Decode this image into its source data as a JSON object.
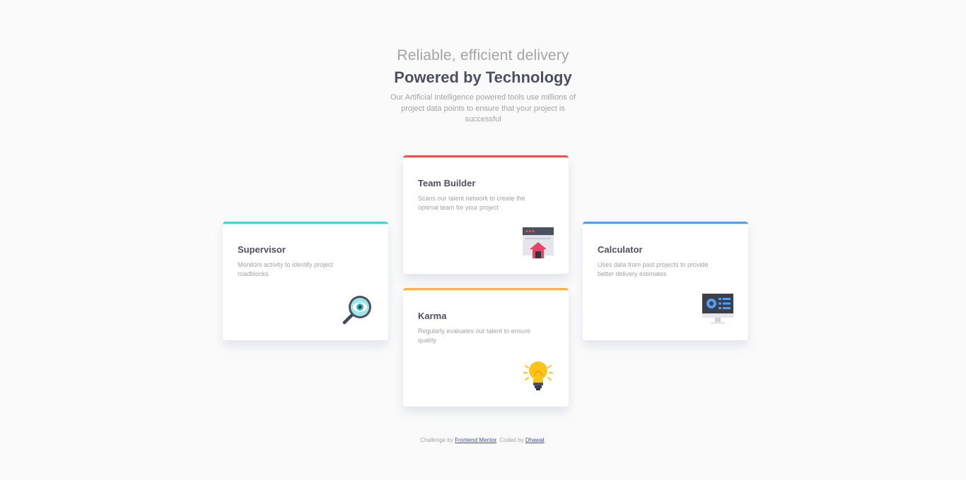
{
  "header": {
    "subtitle": "Reliable, efficient delivery",
    "title": "Powered by Technology",
    "intro": "Our Artificial Intelligence powered tools use millions of project data points to ensure that your project is successful"
  },
  "cards": {
    "supervisor": {
      "title": "Supervisor",
      "description": "Monitors activity to identify project roadblocks",
      "icon": "magnifier-eye-icon",
      "accent": "#44d3d2"
    },
    "team_builder": {
      "title": "Team Builder",
      "description": "Scans our talent network to create the optimal team for your project",
      "icon": "browser-upload-icon",
      "accent": "#ea5454"
    },
    "karma": {
      "title": "Karma",
      "description": "Regularly evaluates our talent to ensure quality",
      "icon": "lightbulb-icon",
      "accent": "#fcaf4a"
    },
    "calculator": {
      "title": "Calculator",
      "description": "Uses data from past projects to provide better delivery estimates",
      "icon": "monitor-dashboard-icon",
      "accent": "#549ef2"
    }
  },
  "footer": {
    "prefix": "Challenge by ",
    "link1": "Frontend Mentor",
    "middle": ". Coded by ",
    "link2": "Dhawal",
    "suffix": "."
  },
  "colors": {
    "background": "#fafafa",
    "heading": "#4d5060",
    "muted": "#a3a3a3",
    "link": "#3e52a3"
  }
}
